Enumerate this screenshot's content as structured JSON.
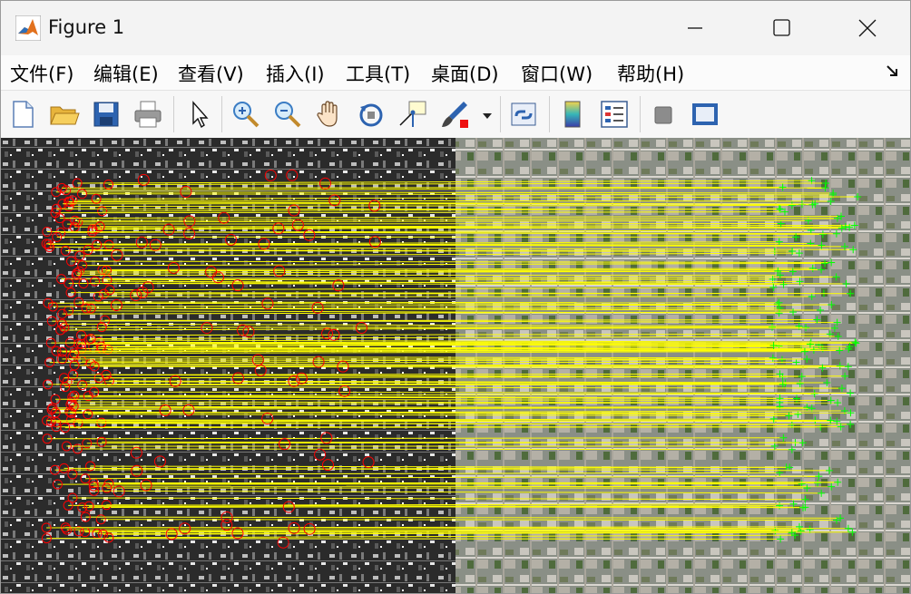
{
  "window": {
    "title": "Figure 1"
  },
  "menu": {
    "items": [
      {
        "label": "文件(F)"
      },
      {
        "label": "编辑(E)"
      },
      {
        "label": "查看(V)"
      },
      {
        "label": "插入(I)"
      },
      {
        "label": "工具(T)"
      },
      {
        "label": "桌面(D)"
      },
      {
        "label": "窗口(W)"
      },
      {
        "label": "帮助(H)"
      }
    ]
  },
  "toolbar": {
    "icons": [
      "new-figure-icon",
      "open-folder-icon",
      "save-icon",
      "print-icon",
      "pointer-arrow-icon",
      "zoom-in-icon",
      "zoom-out-icon",
      "pan-hand-icon",
      "rotate-3d-icon",
      "data-cursor-icon",
      "brush-icon",
      "brush-dropdown-icon",
      "link-plot-icon",
      "colorbar-icon",
      "legend-icon",
      "hide-plot-tools-icon",
      "show-plot-tools-icon"
    ]
  },
  "figure": {
    "left_image": "grayscale satellite image with red circle keypoints",
    "right_image": "color satellite image with green keypoints",
    "match_color": "#ffff00",
    "left_marker_color": "#ff0000",
    "right_marker_color": "#00ff00"
  },
  "colors": {
    "accent": "#ffff00"
  }
}
